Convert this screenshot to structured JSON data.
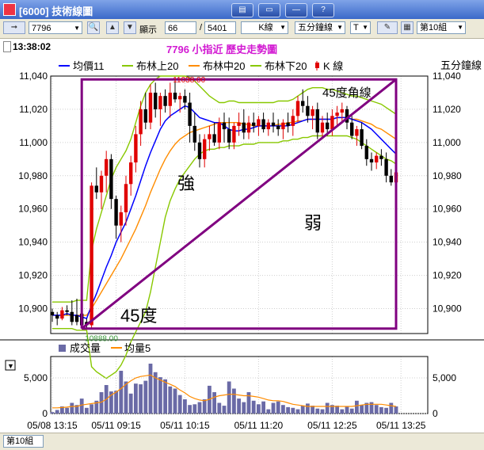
{
  "window": {
    "title": "[6000] 技術線圖",
    "buttons": [
      {
        "icon": "layout-icon"
      },
      {
        "icon": "window-icon"
      },
      {
        "icon": "minimize-icon"
      },
      {
        "label": "?"
      }
    ]
  },
  "toolbar": {
    "symbol_value": "7796",
    "display_label": "顯示",
    "display_count": "66",
    "total_label": "5401",
    "kline_label": "K線",
    "period_label": "五分鐘線",
    "t_label": "T",
    "group_label": "第10組"
  },
  "info": {
    "time": "13:38:02",
    "chart_title": "7796 小指近  歷史走勢圖"
  },
  "colors": {
    "up": "#e00000",
    "down": "#000000",
    "avg": "#0000ff",
    "upper": "#88c800",
    "middle": "#ff8c00",
    "lower": "#88c800",
    "annotation": "#800080",
    "volume": "#6a6aa6",
    "vol_ma": "#ff8c00"
  },
  "chart_data": [
    {
      "type": "candlestick",
      "right_axis_label": "五分鐘線",
      "legend": [
        "均價11",
        "布林上20",
        "布林中20",
        "布林下20",
        "K 線"
      ],
      "ylim": [
        10885,
        11040
      ],
      "yticks": [
        10900,
        10920,
        10940,
        10960,
        10980,
        11000,
        11020,
        11040
      ],
      "ytick_labels": [
        "10,900",
        "10,920",
        "10,940",
        "10,960",
        "10,980",
        "11,000",
        "11,020",
        "11,040"
      ],
      "x_labels": [
        "05/08 13:15",
        "05/11 09:15",
        "05/11 10:15",
        "05/11 11:20",
        "05/11 12:25",
        "05/11 13:25"
      ],
      "x_label_index": [
        0,
        13,
        27,
        42,
        57,
        71
      ],
      "high_marker": "11038.00",
      "low_marker": "10888.00",
      "annotations": [
        "強",
        "弱",
        "45度",
        "45度角線"
      ],
      "candles": [
        [
          10898,
          10900,
          10892,
          10896
        ],
        [
          10896,
          10898,
          10890,
          10894
        ],
        [
          10894,
          10901,
          10893,
          10899
        ],
        [
          10899,
          10902,
          10896,
          10898
        ],
        [
          10898,
          10905,
          10890,
          10892
        ],
        [
          10896,
          10906,
          10890,
          10892
        ],
        [
          10897,
          10899,
          10888,
          10890
        ],
        [
          10892,
          10894,
          10888,
          10890
        ],
        [
          10890,
          10976,
          10888,
          10974
        ],
        [
          10974,
          10985,
          10966,
          10970
        ],
        [
          10970,
          10983,
          10960,
          10980
        ],
        [
          10980,
          10995,
          10970,
          10990
        ],
        [
          10990,
          10993,
          10960,
          10966
        ],
        [
          10966,
          10968,
          10942,
          10950
        ],
        [
          10950,
          10962,
          10940,
          10958
        ],
        [
          10958,
          10980,
          10950,
          10975
        ],
        [
          10975,
          10992,
          10968,
          10988
        ],
        [
          10988,
          11010,
          10982,
          11005
        ],
        [
          11005,
          11025,
          10998,
          11020
        ],
        [
          11020,
          11030,
          11008,
          11012
        ],
        [
          11012,
          11035,
          11008,
          11030
        ],
        [
          11030,
          11036,
          11015,
          11020
        ],
        [
          11020,
          11030,
          11010,
          11028
        ],
        [
          11028,
          11032,
          11018,
          11022
        ],
        [
          11022,
          11036,
          11015,
          11030
        ],
        [
          11030,
          11038,
          11024,
          11026
        ],
        [
          11026,
          11030,
          11018,
          11028
        ],
        [
          11028,
          11032,
          11020,
          11024
        ],
        [
          11024,
          11030,
          11000,
          11010
        ],
        [
          11010,
          11018,
          10995,
          11000
        ],
        [
          11000,
          11005,
          10985,
          10990
        ],
        [
          10990,
          11005,
          10985,
          11002
        ],
        [
          11002,
          11010,
          10995,
          11005
        ],
        [
          11005,
          11012,
          10998,
          11000
        ],
        [
          11000,
          11015,
          10996,
          11012
        ],
        [
          11012,
          11018,
          11000,
          11008
        ],
        [
          11008,
          11015,
          10996,
          11000
        ],
        [
          11000,
          11012,
          10996,
          11010
        ],
        [
          11010,
          11018,
          11004,
          11012
        ],
        [
          11012,
          11020,
          11002,
          11006
        ],
        [
          11006,
          11016,
          11002,
          11012
        ],
        [
          11012,
          11018,
          11006,
          11010
        ],
        [
          11010,
          11016,
          11004,
          11014
        ],
        [
          11014,
          11018,
          11006,
          11008
        ],
        [
          11008,
          11014,
          11004,
          11012
        ],
        [
          11012,
          11018,
          11006,
          11010
        ],
        [
          11010,
          11014,
          11004,
          11008
        ],
        [
          11008,
          11014,
          11002,
          11012
        ],
        [
          11012,
          11018,
          11006,
          11010
        ],
        [
          11010,
          11020,
          11004,
          11016
        ],
        [
          11016,
          11028,
          11012,
          11025
        ],
        [
          11025,
          11032,
          11018,
          11022
        ],
        [
          11022,
          11028,
          11012,
          11016
        ],
        [
          11016,
          11022,
          11008,
          11020
        ],
        [
          11020,
          11024,
          11002,
          11006
        ],
        [
          11006,
          11016,
          11002,
          11012
        ],
        [
          11012,
          11018,
          11004,
          11008
        ],
        [
          11008,
          11020,
          11004,
          11016
        ],
        [
          11016,
          11022,
          11010,
          11018
        ],
        [
          11018,
          11024,
          11012,
          11020
        ],
        [
          11020,
          11022,
          11008,
          11012
        ],
        [
          11012,
          11016,
          11002,
          11004
        ],
        [
          11004,
          11010,
          10998,
          11008
        ],
        [
          11008,
          11012,
          10996,
          10998
        ],
        [
          10998,
          11002,
          10986,
          10990
        ],
        [
          10990,
          10994,
          10983,
          10988
        ],
        [
          10988,
          10994,
          10984,
          10992
        ],
        [
          10992,
          10996,
          10986,
          10990
        ],
        [
          10990,
          10994,
          10976,
          10980
        ],
        [
          10980,
          10984,
          10974,
          10976
        ],
        [
          10976,
          10984,
          10972,
          10982
        ]
      ],
      "ma11": [
        10896,
        10896,
        10896,
        10897,
        10896,
        10896,
        10895,
        10894,
        10902,
        10909,
        10917,
        10925,
        10932,
        10940,
        10946,
        10952,
        10960,
        10968,
        10977,
        10986,
        10994,
        11001,
        11008,
        11013,
        11016,
        11018,
        11020,
        11022,
        11021,
        11018,
        11015,
        11014,
        11013,
        11012,
        11012,
        11010,
        11008,
        11007,
        11007,
        11008,
        11008,
        11009,
        11010,
        11010,
        11010,
        11010,
        11010,
        11010,
        11010,
        11011,
        11012,
        11013,
        11014,
        11014,
        11014,
        11014,
        11014,
        11014,
        11015,
        11015,
        11015,
        11014,
        11013,
        11012,
        11010,
        11008,
        11005,
        11002,
        10999,
        10996,
        10993
      ],
      "bb_upper": [
        10904,
        10904,
        10904,
        10904,
        10904,
        10905,
        10905,
        10905,
        10935,
        10948,
        10958,
        10968,
        10978,
        10985,
        10990,
        10995,
        11002,
        11012,
        11022,
        11030,
        11035,
        11038,
        11040,
        11040,
        11040,
        11040,
        11040,
        11040,
        11039,
        11037,
        11034,
        11031,
        11028,
        11026,
        11024,
        11024,
        11025,
        11025,
        11024,
        11024,
        11024,
        11024,
        11024,
        11024,
        11024,
        11024,
        11025,
        11025,
        11025,
        11026,
        11028,
        11030,
        11032,
        11033,
        11033,
        11033,
        11032,
        11032,
        11031,
        11030,
        11029,
        11028,
        11028,
        11027,
        11026,
        11025,
        11024,
        11023,
        11021,
        11019,
        11017
      ],
      "bb_mid": [
        10896,
        10896,
        10896,
        10896,
        10896,
        10896,
        10896,
        10896,
        10900,
        10905,
        10910,
        10915,
        10920,
        10925,
        10930,
        10936,
        10942,
        10948,
        10955,
        10962,
        10970,
        10977,
        10984,
        10990,
        10995,
        10999,
        11002,
        11004,
        11006,
        11007,
        11008,
        11009,
        11010,
        11011,
        11012,
        11012,
        11012,
        11012,
        11012,
        11011,
        11011,
        11010,
        11010,
        11010,
        11010,
        11010,
        11011,
        11011,
        11012,
        11012,
        11013,
        11013,
        11014,
        11014,
        11014,
        11014,
        11014,
        11014,
        11015,
        11015,
        11015,
        11014,
        11014,
        11013,
        11012,
        11011,
        11009,
        11008,
        11006,
        11004,
        11002
      ],
      "bb_lower": [
        10888,
        10888,
        10888,
        10888,
        10888,
        10887,
        10887,
        10887,
        10865,
        10862,
        10860,
        10858,
        10860,
        10862,
        10866,
        10872,
        10880,
        10886,
        10892,
        10898,
        10910,
        10925,
        10940,
        10955,
        10965,
        10972,
        10978,
        10982,
        10986,
        10990,
        10993,
        10995,
        10996,
        10996,
        10997,
        10997,
        10998,
        10998,
        10998,
        10999,
        10999,
        10999,
        11000,
        11000,
        11000,
        11000,
        11000,
        11001,
        11001,
        11002,
        11002,
        11003,
        11003,
        11004,
        11004,
        11004,
        11004,
        11004,
        11004,
        11004,
        11004,
        11003,
        11002,
        11000,
        10998,
        10996,
        10994,
        10992,
        10990,
        10989,
        10987
      ]
    },
    {
      "type": "bar",
      "legend": [
        "成交量",
        "均量5"
      ],
      "ylim": [
        0,
        8000
      ],
      "yticks": [
        0,
        5000
      ],
      "ytick_labels": [
        "0",
        "5,000"
      ],
      "volume": [
        200,
        500,
        1000,
        800,
        1500,
        1200,
        2100,
        800,
        1300,
        1800,
        3000,
        4000,
        3100,
        3200,
        6000,
        4500,
        2800,
        4200,
        4100,
        4600,
        7000,
        5800,
        5100,
        4800,
        3800,
        3500,
        2600,
        2000,
        1200,
        1300,
        1600,
        2000,
        3900,
        3000,
        1500,
        1100,
        4500,
        3500,
        2100,
        1600,
        3000,
        1800,
        1300,
        1700,
        600,
        1500,
        1700,
        1200,
        900,
        800,
        600,
        1100,
        1400,
        1100,
        700,
        600,
        1500,
        1200,
        1100,
        600,
        1000,
        700,
        1800,
        1200,
        1500,
        1600,
        1200,
        900,
        800,
        1500,
        1000
      ],
      "vol_ma": [
        800,
        800,
        850,
        900,
        1000,
        1000,
        1200,
        1300,
        1400,
        1500,
        1600,
        2000,
        2600,
        3000,
        3500,
        4100,
        4600,
        5000,
        5200,
        5300,
        5400,
        5000,
        4700,
        4400,
        4100,
        3800,
        3300,
        2900,
        2400,
        2100,
        1900,
        1800,
        2000,
        2300,
        2500,
        2600,
        2700,
        2700,
        2600,
        2500,
        2500,
        2400,
        2300,
        2100,
        1900,
        1800,
        1800,
        1700,
        1500,
        1300,
        1200,
        1100,
        1000,
        1000,
        1000,
        1000,
        1000,
        1000,
        1000,
        1000,
        1000,
        1000,
        1100,
        1200,
        1300,
        1300,
        1300,
        1300,
        1200,
        1100,
        1000
      ]
    }
  ],
  "status": {
    "group_label": "第10組"
  }
}
